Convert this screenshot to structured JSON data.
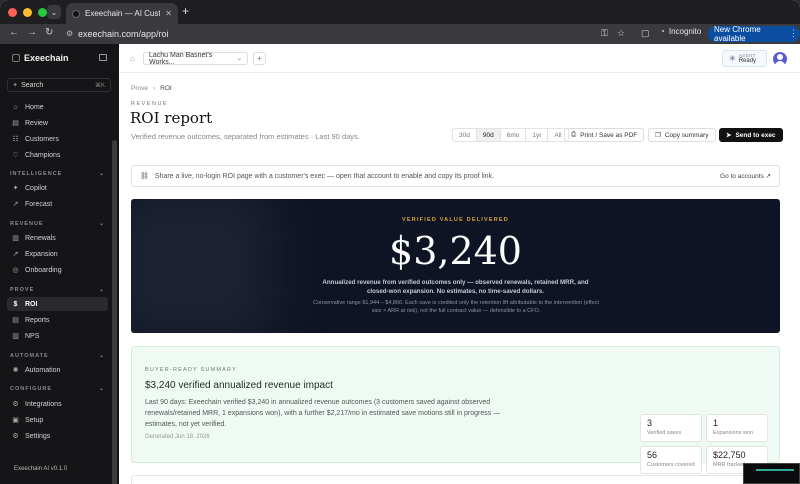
{
  "browser": {
    "tab_title": "Exeechain — AI Customer Su...",
    "url": "exeechain.com/app/roi",
    "incognito_label": "Incognito",
    "update_label": "New Chrome available"
  },
  "sidebar": {
    "brand": "Exeechain",
    "search_label": "Search",
    "search_shortcut": "⌘K",
    "items_top": [
      {
        "label": "Home",
        "icon": "home-icon",
        "glyph": "⌂"
      },
      {
        "label": "Review",
        "icon": "inbox-icon",
        "glyph": "▤"
      },
      {
        "label": "Customers",
        "icon": "users-icon",
        "glyph": "☷"
      },
      {
        "label": "Champions",
        "icon": "heart-icon",
        "glyph": "♡"
      }
    ],
    "sections": {
      "intelligence": "INTELLIGENCE",
      "revenue": "REVENUE",
      "prove": "PROVE",
      "automate": "AUTOMATE",
      "configure": "CONFIGURE"
    },
    "intelligence_items": [
      {
        "label": "Copilot",
        "glyph": "✦"
      },
      {
        "label": "Forecast",
        "glyph": "↗"
      }
    ],
    "revenue_items": [
      {
        "label": "Renewals",
        "glyph": "▥"
      },
      {
        "label": "Expansion",
        "glyph": "↗"
      },
      {
        "label": "Onboarding",
        "glyph": "◎"
      }
    ],
    "prove_items": [
      {
        "label": "ROI",
        "glyph": "$"
      },
      {
        "label": "Reports",
        "glyph": "▤"
      },
      {
        "label": "NPS",
        "glyph": "▥"
      }
    ],
    "automate_items": [
      {
        "label": "Automation",
        "glyph": "✺"
      }
    ],
    "configure_items": [
      {
        "label": "Integrations",
        "glyph": "⚙"
      },
      {
        "label": "Setup",
        "glyph": "▣"
      },
      {
        "label": "Settings",
        "glyph": "⚙"
      }
    ],
    "version": "Exeechain AI v0.1.0"
  },
  "topbar": {
    "workspace": "Lachu Man Basnet's Works...",
    "agent_label": "AGENT",
    "agent_status": "Ready"
  },
  "page": {
    "breadcrumb_root": "Prove",
    "breadcrumb_current": "ROI",
    "eyebrow": "REVENUE",
    "title": "ROI report",
    "subtitle": "Verified revenue outcomes, separated from estimates · Last 90 days.",
    "ranges": [
      "30d",
      "90d",
      "6mo",
      "1yr",
      "All"
    ],
    "active_range": "90d",
    "print_label": "Print / Save as PDF",
    "copy_label": "Copy summary",
    "send_label": "Send to exec"
  },
  "share": {
    "text": "Share a live, no-login ROI page with a customer's exec — open that account to enable and copy its proof link.",
    "link": "Go to accounts ↗"
  },
  "hero": {
    "eyebrow": "VERIFIED VALUE DELIVERED",
    "value": "$3,240",
    "line1": "Annualized revenue from verified outcomes only — observed renewals, retained MRR, and closed-won expansion. No estimates, no time-saved dollars.",
    "line2": "Conservative range $1,944 – $4,860. Each save is credited only the retention lift attributable to the intervention (effect size × ARR at risk), not the full contract value — defensible to a CFO."
  },
  "summary": {
    "eyebrow": "BUYER-READY SUMMARY",
    "title": "$3,240 verified annualized revenue impact",
    "body": "Last 90 days: Exeechain verified $3,240 in annualized revenue outcomes (3 customers saved against observed renewals/retained MRR, 1 expansions won), with a further $2,217/mo in estimated save motions still in progress — estimates, not yet verified.",
    "date": "Generated Jun 18, 2026",
    "stats": [
      {
        "value": "3",
        "label": "Verified saves"
      },
      {
        "value": "1",
        "label": "Expansions won"
      },
      {
        "value": "56",
        "label": "Customers covered"
      },
      {
        "value": "$22,750",
        "label": "MRR tracked"
      }
    ]
  }
}
